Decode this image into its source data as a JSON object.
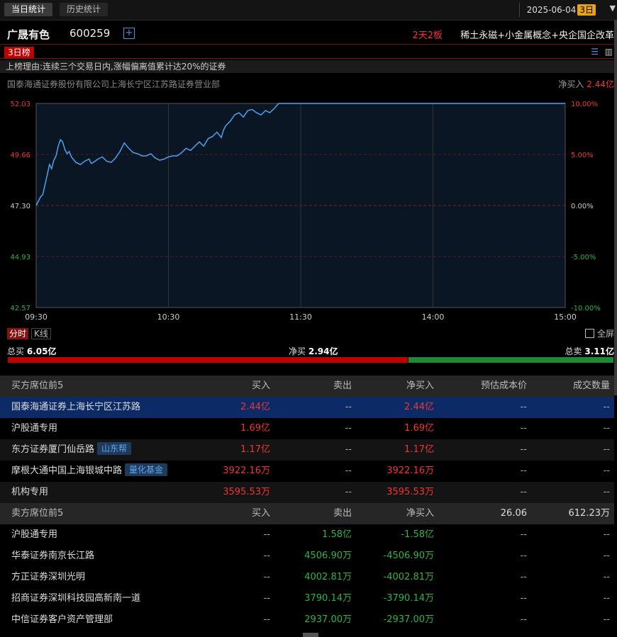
{
  "tabs": {
    "today": "当日统计",
    "history": "历史统计"
  },
  "date": {
    "value": "2025-06-04",
    "days": "3日"
  },
  "stock": {
    "name": "广晟有色",
    "code": "600259",
    "board": "2天2板",
    "concepts": "稀土永磁+小金属概念+央企国企改革"
  },
  "rank_tab": "3日榜",
  "reason": "上榜理由:连续三个交易日内,涨幅偏离值累计达20%的证券",
  "broker": {
    "name": "国泰海通证券股份有限公司上海长宁区江苏路证券营业部",
    "netbuy_label": "净买入",
    "netbuy_value": "2.44亿"
  },
  "timeframe": {
    "intraday": "分时",
    "kline": "K线",
    "fullscreen": "全屏"
  },
  "summary": {
    "total_buy_label": "总买",
    "total_buy": "6.05亿",
    "net_buy_label": "净买",
    "net_buy": "2.94亿",
    "total_sell_label": "总卖",
    "total_sell": "3.11亿",
    "buy_ratio": 0.66
  },
  "colors": {
    "up": "#f03434",
    "down": "#2fb344",
    "line": "#4aa3f0",
    "accent": "#c00000"
  },
  "buy_header": {
    "title": "买方席位前5",
    "buy": "买入",
    "sell": "卖出",
    "net": "净买入",
    "cost": "预估成本价",
    "vol": "成交数量"
  },
  "buy_rows": [
    {
      "name": "国泰海通证券上海长宁区江苏路",
      "tag": "",
      "buy": "2.44亿",
      "sell": "--",
      "net": "2.44亿",
      "cost": "--",
      "vol": "--"
    },
    {
      "name": "沪股通专用",
      "tag": "",
      "buy": "1.69亿",
      "sell": "--",
      "net": "1.69亿",
      "cost": "--",
      "vol": "--"
    },
    {
      "name": "东方证券厦门仙岳路",
      "tag": "山东帮",
      "buy": "1.17亿",
      "sell": "--",
      "net": "1.17亿",
      "cost": "--",
      "vol": "--"
    },
    {
      "name": "摩根大通中国上海银城中路",
      "tag": "量化基金",
      "buy": "3922.16万",
      "sell": "--",
      "net": "3922.16万",
      "cost": "--",
      "vol": "--"
    },
    {
      "name": "机构专用",
      "tag": "",
      "buy": "3595.53万",
      "sell": "--",
      "net": "3595.53万",
      "cost": "--",
      "vol": "--"
    }
  ],
  "sell_header": {
    "title": "卖方席位前5",
    "buy": "买入",
    "sell": "卖出",
    "net": "净买入",
    "cost": "26.06",
    "vol": "612.23万"
  },
  "sell_rows": [
    {
      "name": "沪股通专用",
      "buy": "--",
      "sell": "1.58亿",
      "net": "-1.58亿",
      "cost": "--",
      "vol": "--"
    },
    {
      "name": "华泰证券南京长江路",
      "buy": "--",
      "sell": "4506.90万",
      "net": "-4506.90万",
      "cost": "--",
      "vol": "--"
    },
    {
      "name": "方正证券深圳光明",
      "buy": "--",
      "sell": "4002.81万",
      "net": "-4002.81万",
      "cost": "--",
      "vol": "--"
    },
    {
      "name": "招商证券深圳科技园高新南一道",
      "buy": "--",
      "sell": "3790.14万",
      "net": "-3790.14万",
      "cost": "--",
      "vol": "--"
    },
    {
      "name": "中信证券客户资产管理部",
      "buy": "--",
      "sell": "2937.00万",
      "net": "-2937.00万",
      "cost": "--",
      "vol": "--"
    }
  ],
  "chart_data": {
    "type": "line",
    "title": "",
    "xlabel": "",
    "ylabel": "",
    "x_ticks": [
      "09:30",
      "10:30",
      "11:30",
      "14:00",
      "15:00"
    ],
    "y_ticks_price": [
      "52.03",
      "49.66",
      "47.30",
      "44.93",
      "42.57"
    ],
    "y_ticks_pct": [
      "10.00%",
      "5.00%",
      "0.00%",
      "-5.00%",
      "-10.00%"
    ],
    "ylim": [
      42.57,
      52.03
    ],
    "xlim": [
      0,
      240
    ],
    "series": [
      {
        "x": [
          0,
          2,
          3,
          5,
          6,
          7,
          8,
          9,
          10,
          11,
          12,
          13,
          14,
          15,
          16,
          18,
          20,
          22,
          24,
          25,
          26,
          28,
          30,
          32,
          34,
          36,
          38,
          40,
          42,
          44,
          46,
          48,
          50,
          52,
          54,
          56,
          58,
          60,
          62,
          64,
          66,
          68,
          70,
          72,
          74,
          76,
          78,
          80,
          82,
          84,
          85,
          86,
          88,
          90,
          92,
          94,
          96,
          98,
          100,
          102,
          104,
          106,
          108,
          110,
          240
        ],
        "y": [
          47.3,
          47.7,
          47.8,
          48.7,
          49.2,
          49.0,
          49.4,
          49.6,
          50.05,
          50.35,
          50.25,
          49.9,
          49.7,
          49.8,
          49.55,
          49.3,
          49.2,
          49.35,
          49.45,
          49.25,
          49.3,
          49.45,
          49.55,
          49.35,
          49.3,
          49.5,
          49.8,
          50.2,
          49.95,
          49.75,
          49.7,
          49.6,
          49.6,
          49.7,
          49.5,
          49.4,
          49.45,
          49.55,
          49.6,
          49.6,
          49.75,
          49.95,
          49.85,
          50.05,
          50.25,
          50.05,
          50.4,
          50.5,
          50.7,
          50.45,
          50.8,
          51.0,
          51.2,
          51.5,
          51.6,
          51.4,
          51.7,
          51.75,
          51.6,
          51.5,
          51.7,
          51.6,
          51.8,
          52.03,
          52.03
        ]
      }
    ]
  }
}
